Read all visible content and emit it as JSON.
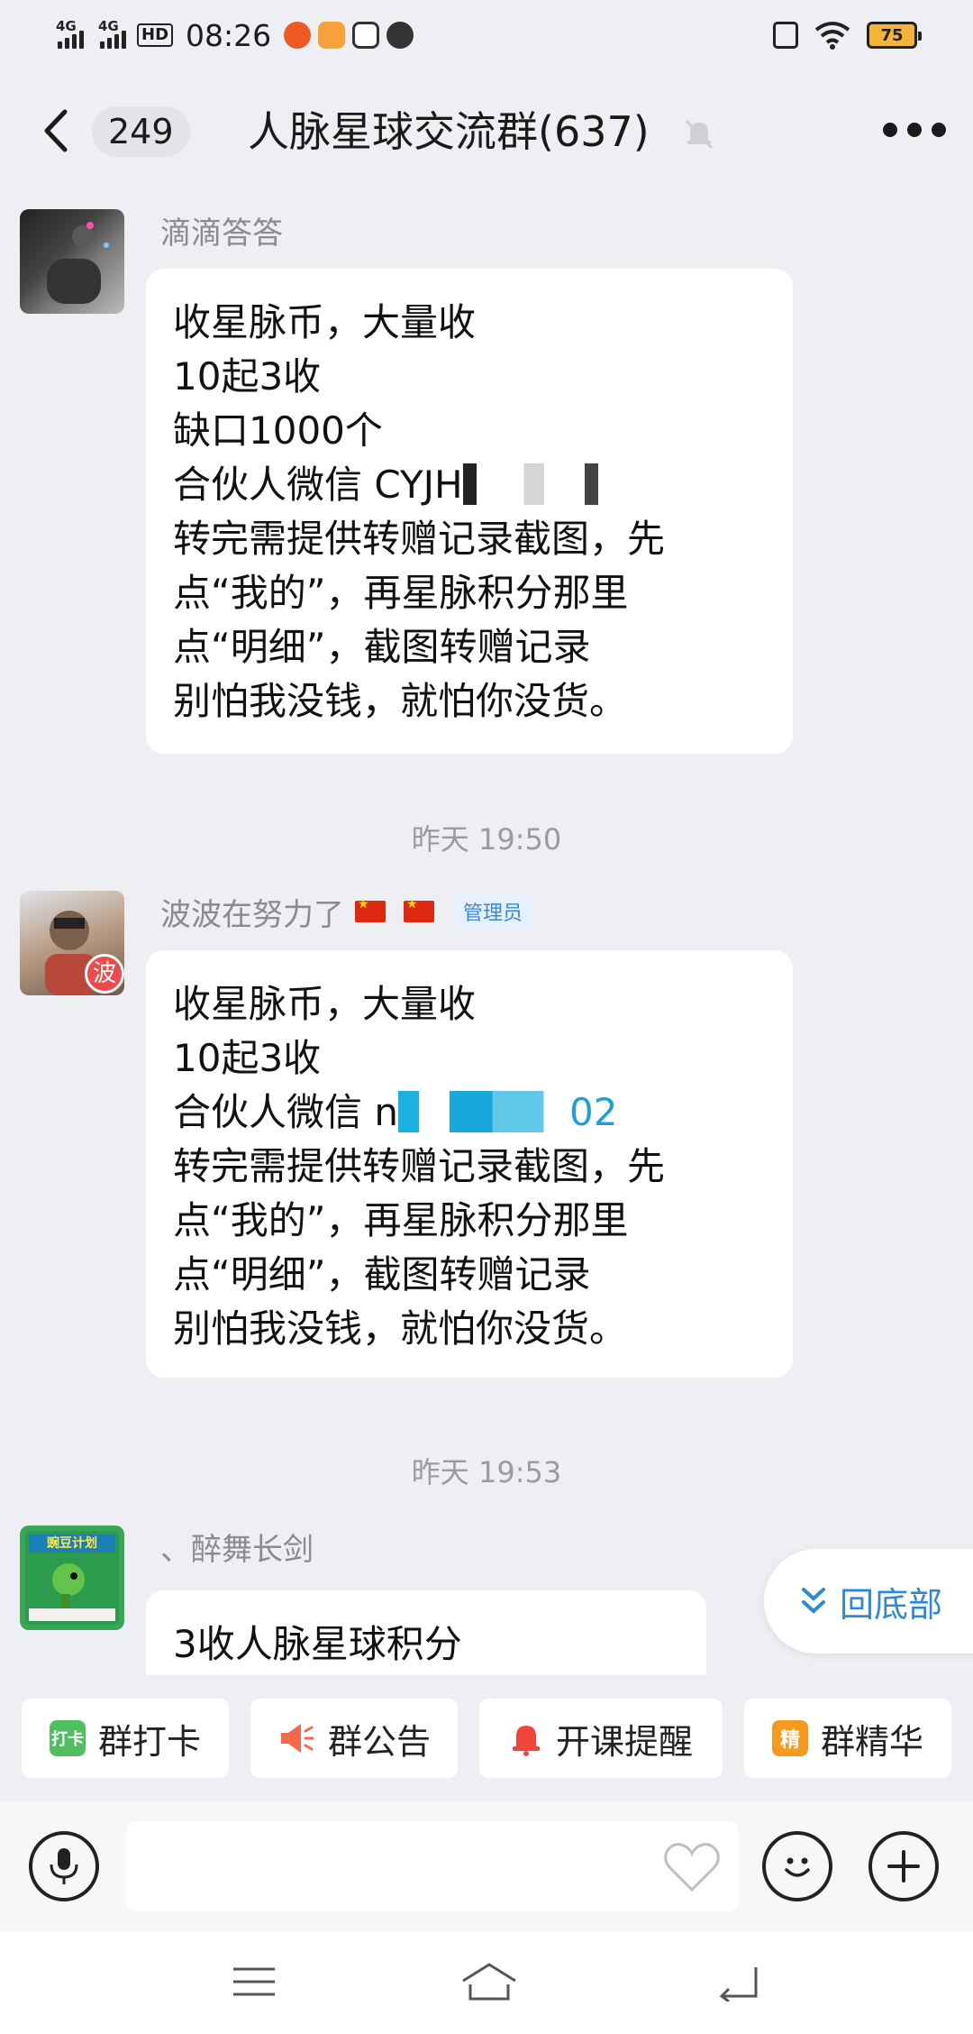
{
  "status_bar": {
    "signal1": "4G",
    "signal2": "4G",
    "hd": "HD",
    "time": "08:26",
    "battery": "75"
  },
  "header": {
    "unread_count": "249",
    "title": "人脉星球交流群(637)"
  },
  "messages": [
    {
      "sender": "滴滴答答",
      "lines": [
        "收星脉币，大量收",
        "10起3收",
        "缺口1000个",
        "合伙人微信 CYJH",
        "转完需提供转赠记录截图，先",
        "点“我的”，再星脉积分那里",
        "点“明细”，截图转赠记录",
        "别怕我没钱，就怕你没货。"
      ]
    },
    {
      "time": "昨天 19:50",
      "sender": "波波在努力了",
      "role_badge": "管理员",
      "avatar_badge": "波",
      "lines": [
        "收星脉币，大量收",
        "10起3收",
        "合伙人微信 n",
        "02",
        "转完需提供转赠记录截图，先",
        "点“我的”，再星脉积分那里",
        "点“明细”，截图转赠记录",
        "别怕我没钱，就怕你没货。"
      ]
    },
    {
      "time": "昨天 19:53",
      "sender": "、醉舞长剑",
      "avatar_text": "豌豆计划",
      "lines": [
        "3收人脉星球积分"
      ]
    }
  ],
  "jump_to_bottom": "回底部",
  "quick_actions": [
    {
      "label": "群打卡",
      "icon": "checkin-icon",
      "icon_text": "打卡",
      "color": "#4fbf62"
    },
    {
      "label": "群公告",
      "icon": "announcement-icon",
      "color": "#f26a4b"
    },
    {
      "label": "开课提醒",
      "icon": "bell-icon",
      "color": "#f0463a"
    },
    {
      "label": "群精华",
      "icon": "essence-icon",
      "icon_text": "精",
      "color": "#f59a1d"
    }
  ]
}
